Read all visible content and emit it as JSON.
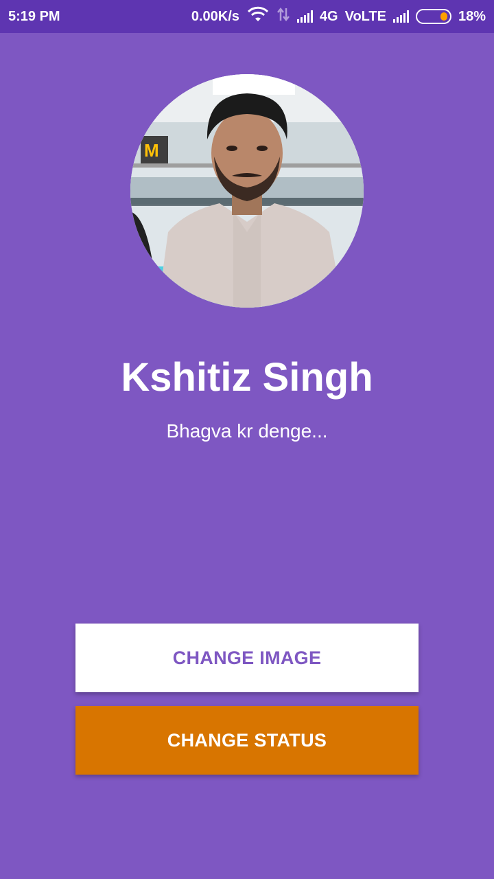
{
  "status_bar": {
    "time": "5:19 PM",
    "network_speed": "0.00K/s",
    "network_type": "4G",
    "volte": "VoLTE",
    "battery": "18%"
  },
  "profile": {
    "name": "Kshitiz Singh",
    "status": "Bhagva kr denge..."
  },
  "buttons": {
    "change_image": "CHANGE IMAGE",
    "change_status": "CHANGE STATUS"
  },
  "colors": {
    "background": "#7E57C2",
    "status_bar": "#5E35B1",
    "status_button": "#D87500"
  }
}
